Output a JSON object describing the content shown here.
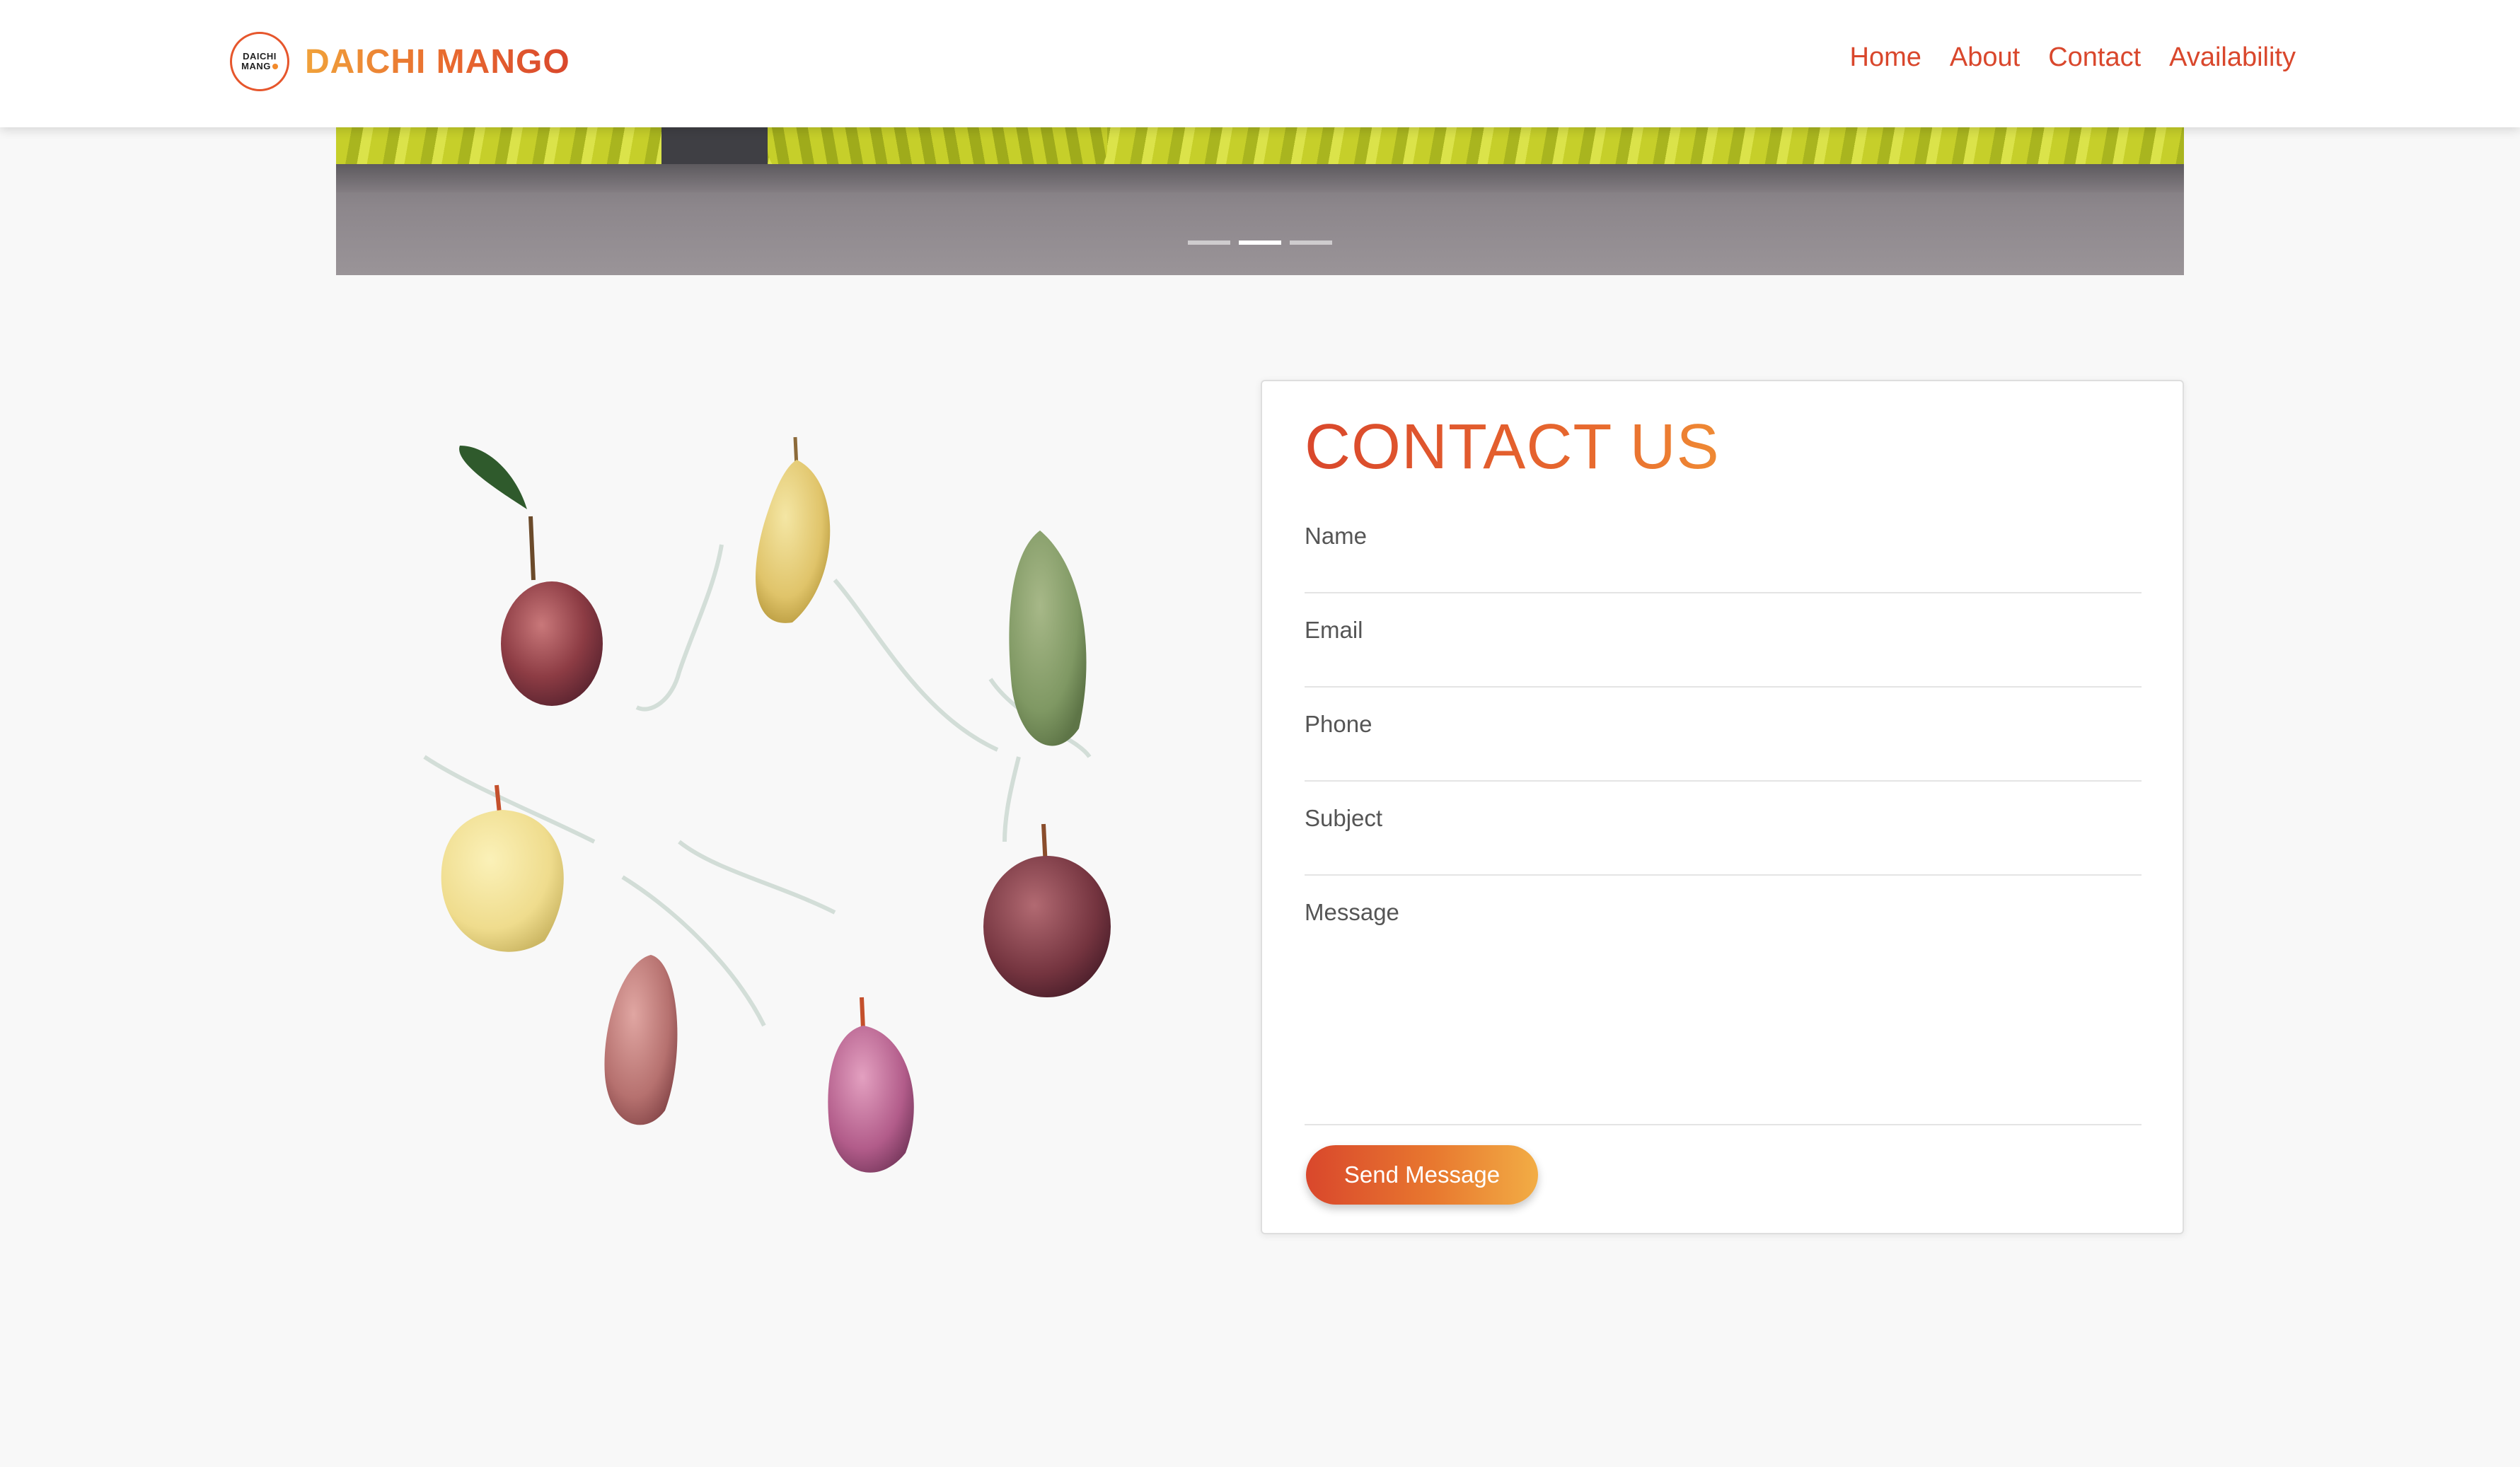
{
  "brand": {
    "logo_line1": "DAICHI",
    "logo_line2": "MANG",
    "name": "DAICHI MANGO"
  },
  "nav": {
    "items": [
      {
        "label": "Home"
      },
      {
        "label": "About"
      },
      {
        "label": "Contact"
      },
      {
        "label": "Availability"
      }
    ]
  },
  "slider": {
    "slide_count": 3,
    "active_index": 1
  },
  "contact": {
    "title": "CONTACT US",
    "fields": {
      "name": {
        "label": "Name",
        "value": ""
      },
      "email": {
        "label": "Email",
        "value": ""
      },
      "phone": {
        "label": "Phone",
        "value": ""
      },
      "subject": {
        "label": "Subject",
        "value": ""
      },
      "message": {
        "label": "Message",
        "value": ""
      }
    },
    "submit_label": "Send Message"
  },
  "colors": {
    "accent": "#d9472c",
    "accent_light": "#f2ad45",
    "background": "#f8f8f8"
  }
}
